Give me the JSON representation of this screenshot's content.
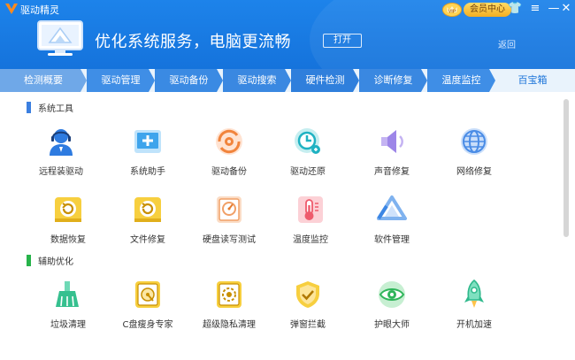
{
  "window": {
    "title": "驱动精灵",
    "controls": {
      "skin": "👕",
      "menu": "≡",
      "minimize": "—"
    }
  },
  "banner": {
    "slogan": "优化系统服务，电脑更流畅",
    "open_button": "打开",
    "return_link": "返回"
  },
  "vip": {
    "badge": "VIP",
    "member_center": "会员中心"
  },
  "tabs": [
    {
      "label": "检测概要",
      "color": "#6fa8e8"
    },
    {
      "label": "驱动管理",
      "color": "#3f8ee6"
    },
    {
      "label": "驱动备份",
      "color": "#3a8ae3"
    },
    {
      "label": "驱动搜索",
      "color": "#3a88e1"
    },
    {
      "label": "硬件检测",
      "color": "#2f7fdc"
    },
    {
      "label": "诊断修复",
      "color": "#3a88e1"
    },
    {
      "label": "温度监控",
      "color": "#3f8ee6"
    },
    {
      "label": "百宝箱",
      "color": "#1a73d9"
    }
  ],
  "sections": {
    "system_tools": {
      "title": "系统工具",
      "color": "#3b7fe0"
    },
    "assist": {
      "title": "辅助优化",
      "color": "#27b34a"
    }
  },
  "system_tools": [
    {
      "label": "远程装驱动",
      "icon": "remote-driver-icon"
    },
    {
      "label": "系统助手",
      "icon": "system-assistant-icon"
    },
    {
      "label": "驱动备份",
      "icon": "driver-backup-icon"
    },
    {
      "label": "驱动还原",
      "icon": "driver-restore-icon"
    },
    {
      "label": "声音修复",
      "icon": "sound-repair-icon"
    },
    {
      "label": "网络修复",
      "icon": "network-repair-icon"
    },
    {
      "label": "数据恢复",
      "icon": "data-recovery-icon"
    },
    {
      "label": "文件修复",
      "icon": "file-repair-icon"
    },
    {
      "label": "硬盘读写测试",
      "icon": "disk-test-icon"
    },
    {
      "label": "温度监控",
      "icon": "temperature-icon"
    },
    {
      "label": "软件管理",
      "icon": "software-manager-icon"
    }
  ],
  "assist_tools": [
    {
      "label": "垃圾清理",
      "icon": "junk-clean-icon"
    },
    {
      "label": "C盘瘦身专家",
      "icon": "c-drive-slim-icon"
    },
    {
      "label": "超级隐私清理",
      "icon": "privacy-clean-icon"
    },
    {
      "label": "弹窗拦截",
      "icon": "popup-block-icon"
    },
    {
      "label": "护眼大师",
      "icon": "eye-care-icon"
    },
    {
      "label": "开机加速",
      "icon": "boot-speedup-icon"
    }
  ]
}
